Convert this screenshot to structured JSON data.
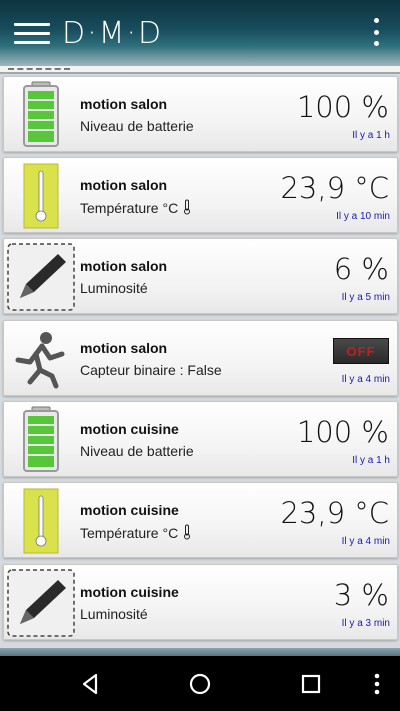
{
  "app": {
    "logo_text": "D·M·D",
    "menu_icon": "hamburger-menu-icon",
    "overflow_icon": "more-vert-icon"
  },
  "colors": {
    "header": "#184d5d",
    "time_text": "#1a1ab0",
    "battery_green": "#57c837",
    "thermo_yellow": "#d6e346",
    "off_red": "#b22222"
  },
  "devices": [
    {
      "name": "motion salon",
      "description": "Niveau de batterie",
      "value": "100 %",
      "time": "Il y a 1 h",
      "icon": "battery-icon",
      "battery_level": 1.0
    },
    {
      "name": "motion salon",
      "description": "Température °C",
      "value": "23,9 °C",
      "time": "Il y a 10 min",
      "icon": "thermometer-icon"
    },
    {
      "name": "motion salon",
      "description": "Luminosité",
      "value": "6 %",
      "time": "Il y a 5 min",
      "icon": "pen-icon"
    },
    {
      "name": "motion salon",
      "description": "Capteur binaire : False",
      "value": "OFF",
      "time": "Il y a 4 min",
      "icon": "running-person-icon"
    },
    {
      "name": "motion cuisine",
      "description": "Niveau de batterie",
      "value": "100 %",
      "time": "Il y a 1 h",
      "icon": "battery-icon",
      "battery_level": 1.0
    },
    {
      "name": "motion cuisine",
      "description": "Température °C",
      "value": "23,9 °C",
      "time": "Il y a 4 min",
      "icon": "thermometer-icon"
    },
    {
      "name": "motion cuisine",
      "description": "Luminosité",
      "value": "3 %",
      "time": "Il y a 3 min",
      "icon": "pen-icon"
    }
  ],
  "navbar": {
    "back_icon": "back-triangle-icon",
    "home_icon": "home-circle-icon",
    "recents_icon": "recents-square-icon",
    "more_icon": "more-vert-icon"
  }
}
